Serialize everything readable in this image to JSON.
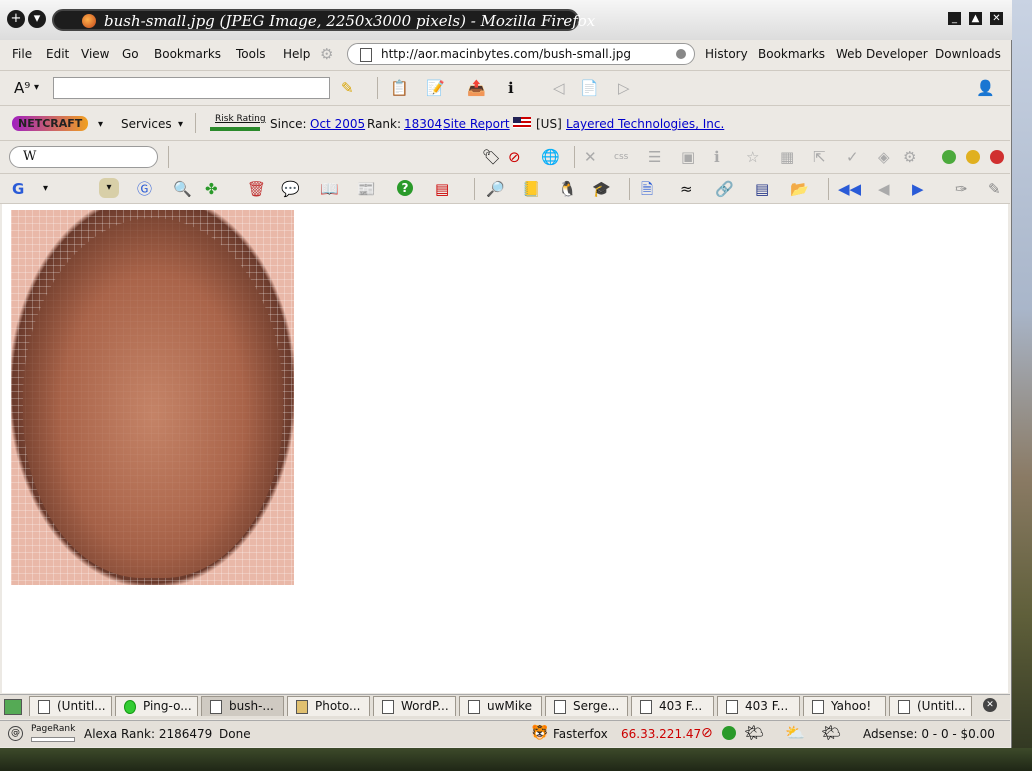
{
  "window": {
    "title": "bush-small.jpg (JPEG Image, 2250x3000 pixels) - Mozilla Firefox"
  },
  "menu": {
    "items": [
      "File",
      "Edit",
      "View",
      "Go",
      "Bookmarks",
      "Tools",
      "Help"
    ],
    "url": "http://aor.macinbytes.com/bush-small.jpg",
    "right_links": [
      "History",
      "Bookmarks",
      "Web Developer",
      "Downloads"
    ]
  },
  "netcraft": {
    "logo": "NETCRAFT",
    "services": "Services",
    "risk_label": "Risk Rating",
    "since_label": "Since:",
    "since_value": "Oct 2005",
    "rank_label": "Rank:",
    "rank_value": "18304",
    "site_report": "Site Report",
    "country": "[US]",
    "host": "Layered Technologies, Inc."
  },
  "wiki": {
    "logo": "W"
  },
  "tabs": [
    {
      "label": "(Untitl...",
      "active": false
    },
    {
      "label": "Ping-o...",
      "active": false
    },
    {
      "label": "bush-...",
      "active": true
    },
    {
      "label": "Photo...",
      "active": false
    },
    {
      "label": "WordP...",
      "active": false
    },
    {
      "label": "uwMike",
      "active": false
    },
    {
      "label": "Serge...",
      "active": false
    },
    {
      "label": "403 F...",
      "active": false
    },
    {
      "label": "403 F...",
      "active": false
    },
    {
      "label": "Yahoo!",
      "active": false
    },
    {
      "label": "(Untitl...",
      "active": false
    }
  ],
  "status": {
    "pagerank_label": "PageRank",
    "alexa": "Alexa Rank: 2186479",
    "done": "Done",
    "fasterfox": "Fasterfox",
    "ip": "66.33.221.47",
    "adsense": "Adsense: 0 - 0 - $0.00"
  },
  "colors": {
    "accent_link": "#0000cc",
    "ip_red": "#cc0000"
  }
}
